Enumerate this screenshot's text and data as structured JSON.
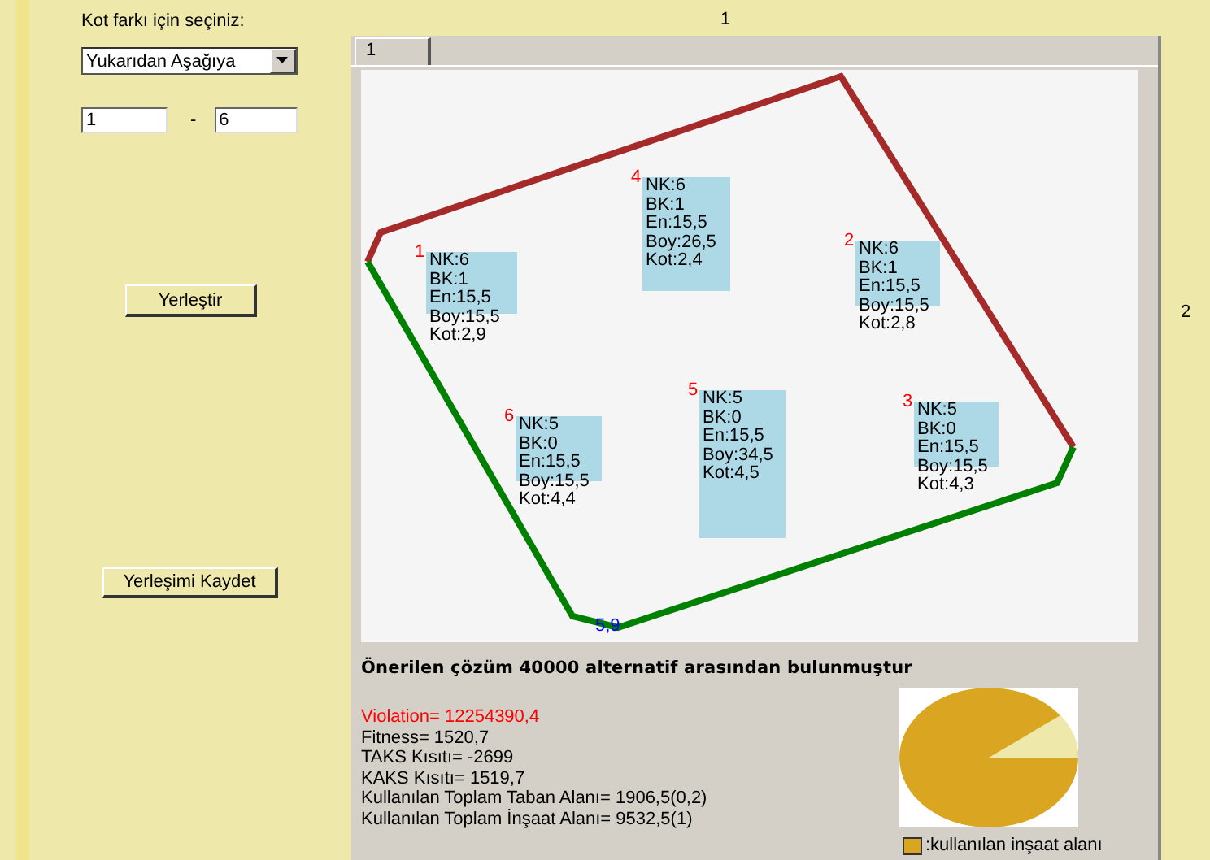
{
  "header": {
    "label": "1"
  },
  "left_panel": {
    "prompt": "Kot farkı için seçiniz:",
    "direction": {
      "value": "Yukarıdan Aşağıya"
    },
    "range_from": {
      "value": "1"
    },
    "range_separator": "-",
    "range_to": {
      "value": "6"
    },
    "buttons": [
      "Yerleştir",
      "Yerleşimi Kaydet"
    ]
  },
  "tabs": [
    {
      "label": "1",
      "selected": true
    }
  ],
  "site": {
    "blocks": [
      {
        "number": "1",
        "lines": [
          "NK:6",
          "BK:1",
          "En:15,5",
          "Boy:15,5",
          "Kot:2,9"
        ]
      },
      {
        "number": "4",
        "lines": [
          "NK:6",
          "BK:1",
          "En:15,5",
          "Boy:26,5",
          "Kot:2,4"
        ]
      },
      {
        "number": "2",
        "lines": [
          "NK:6",
          "BK:1",
          "En:15,5",
          "Boy:15,5",
          "Kot:2,8"
        ]
      },
      {
        "number": "6",
        "lines": [
          "NK:5",
          "BK:0",
          "En:15,5",
          "Boy:15,5",
          "Kot:4,4"
        ]
      },
      {
        "number": "5",
        "lines": [
          "NK:5",
          "BK:0",
          "En:15,5",
          "Boy:34,5",
          "Kot:4,5"
        ]
      },
      {
        "number": "3",
        "lines": [
          "NK:5",
          "BK:0",
          "En:15,5",
          "Boy:15,5",
          "Kot:4,3"
        ]
      }
    ],
    "corner_label": "5,9"
  },
  "result": {
    "headline": "Önerilen çözüm 40000 alternatif arasından bulunmuştur",
    "violation": "Violation= 12254390,4",
    "stats": [
      "Fitness= 1520,7",
      "TAKS Kısıtı= -2699",
      "KAKS Kısıtı= 1519,7",
      "Kullanılan Toplam Taban Alanı= 1906,5(0,2)",
      "Kullanılan Toplam İnşaat Alanı= 9532,5(1)"
    ],
    "legend": ":kullanılan inşaat alanı"
  },
  "side_label": "2"
}
